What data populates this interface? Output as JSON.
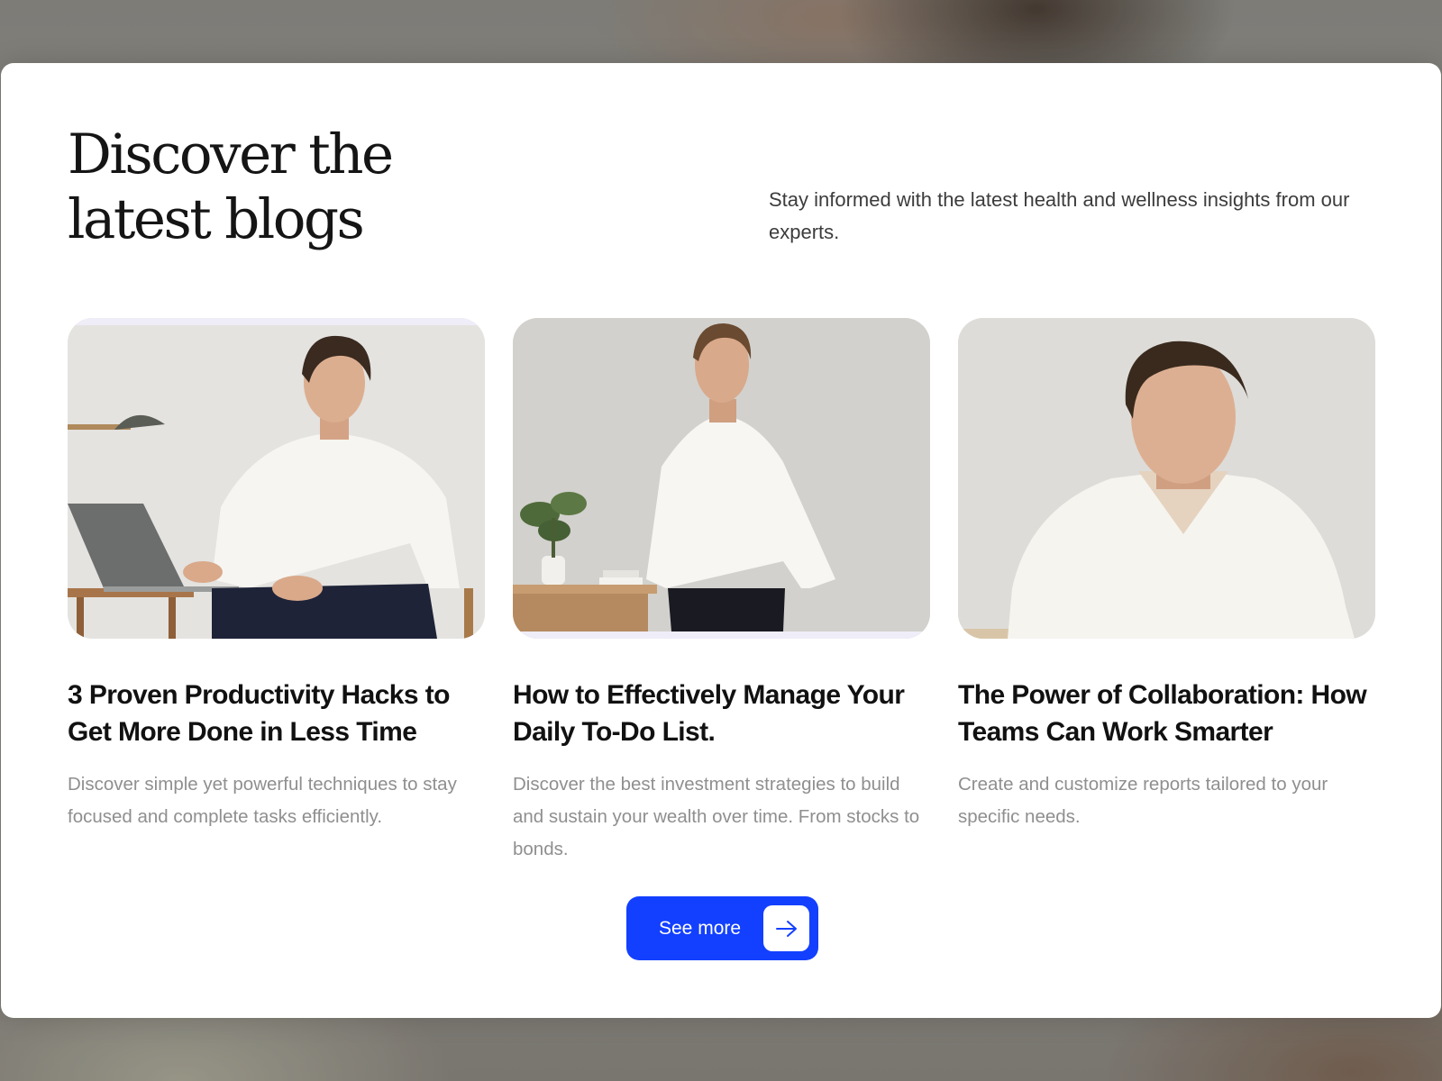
{
  "header": {
    "title_line1": "Discover the",
    "title_line2": "latest blogs",
    "intro": "Stay informed with the latest health and wellness insights from our experts."
  },
  "blogs": [
    {
      "title": "3 Proven Productivity Hacks to Get More Done in Less Time",
      "description": "Discover simple yet powerful techniques to stay focused and complete tasks efficiently."
    },
    {
      "title": "How to Effectively Manage Your Daily To-Do List.",
      "description": "Discover the best investment strategies to build and sustain your wealth over time. From stocks to bonds."
    },
    {
      "title": "The Power of Collaboration: How Teams Can Work Smarter",
      "description": "Create and customize reports tailored to your specific needs."
    }
  ],
  "cta": {
    "label": "See more",
    "icon": "arrow-right-icon"
  },
  "colors": {
    "accent": "#1340ff",
    "heading": "#151515",
    "muted": "#8f8f8f"
  }
}
